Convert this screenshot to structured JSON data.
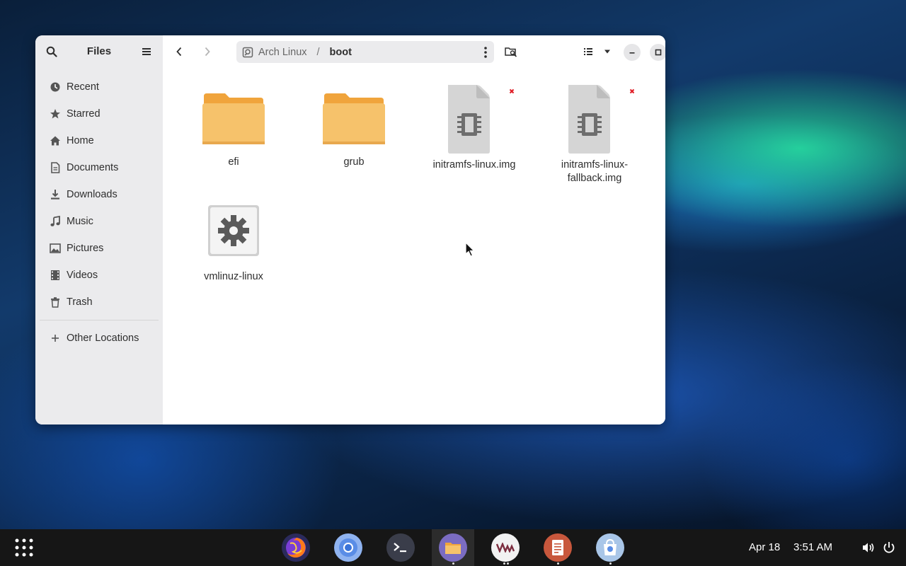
{
  "window": {
    "sidebar": {
      "title": "Files",
      "items": [
        {
          "label": "Recent",
          "icon": "clock-icon"
        },
        {
          "label": "Starred",
          "icon": "star-icon"
        },
        {
          "label": "Home",
          "icon": "home-icon"
        },
        {
          "label": "Documents",
          "icon": "document-icon"
        },
        {
          "label": "Downloads",
          "icon": "download-icon"
        },
        {
          "label": "Music",
          "icon": "music-icon"
        },
        {
          "label": "Pictures",
          "icon": "picture-icon"
        },
        {
          "label": "Videos",
          "icon": "video-icon"
        },
        {
          "label": "Trash",
          "icon": "trash-icon"
        }
      ],
      "other_locations": "Other Locations"
    },
    "path": {
      "root": "Arch Linux",
      "separator": "/",
      "current": "boot"
    },
    "files": [
      {
        "name": "efi",
        "type": "folder"
      },
      {
        "name": "grub",
        "type": "folder"
      },
      {
        "name": "initramfs-linux.img",
        "type": "image",
        "badge": "unreadable"
      },
      {
        "name": "initramfs-linux-fallback.img",
        "type": "image",
        "badge": "unreadable"
      },
      {
        "name": "vmlinuz-linux",
        "type": "executable"
      }
    ]
  },
  "taskbar": {
    "date": "Apr 18",
    "time": "3:51 AM",
    "apps": [
      "firefox",
      "chromium",
      "terminal",
      "files",
      "vmware",
      "text-editor",
      "software-center"
    ]
  },
  "colors": {
    "folder": "#f6c26b",
    "folder_tab": "#f0a43c",
    "accent": "#3584e4",
    "badge_red": "#e01b24"
  }
}
